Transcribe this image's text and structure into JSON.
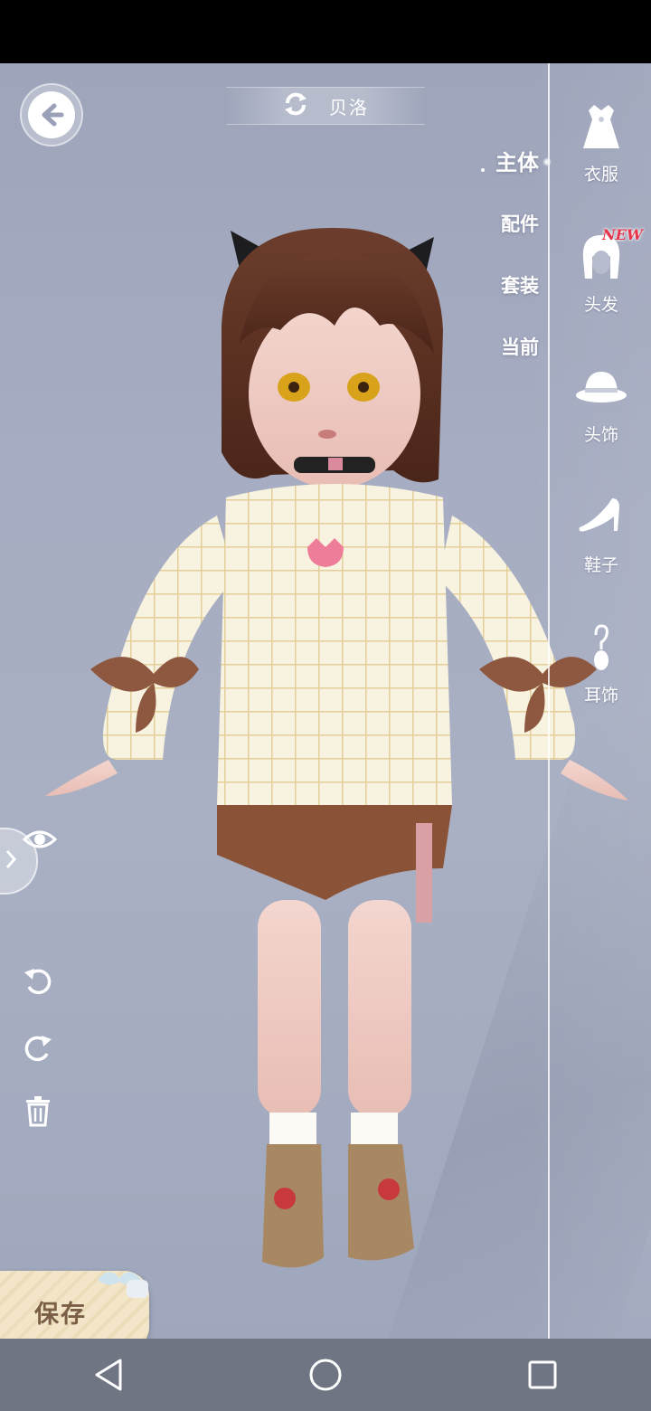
{
  "header": {
    "character_name": "贝洛",
    "back_icon": "arrow-left-icon",
    "swap_icon": "refresh-icon"
  },
  "sub_tabs": [
    {
      "label": "主体",
      "active": true
    },
    {
      "label": "配件",
      "active": false
    },
    {
      "label": "套装",
      "active": false
    },
    {
      "label": "当前",
      "active": false
    }
  ],
  "categories": [
    {
      "label": "衣服",
      "icon": "dress-icon"
    },
    {
      "label": "头发",
      "icon": "hair-icon",
      "badge": "NEW"
    },
    {
      "label": "头饰",
      "icon": "hat-icon"
    },
    {
      "label": "鞋子",
      "icon": "heel-shoe-icon"
    },
    {
      "label": "耳饰",
      "icon": "earring-icon"
    }
  ],
  "tools": {
    "eye": "eye-icon",
    "undo": "undo-icon",
    "redo": "redo-icon",
    "delete": "trash-icon"
  },
  "save_label": "保存",
  "colors": {
    "background": "#a7adc2",
    "new_badge": "#e8344a",
    "save_text": "#7a5e46",
    "nav_bar": "#6f7583"
  }
}
